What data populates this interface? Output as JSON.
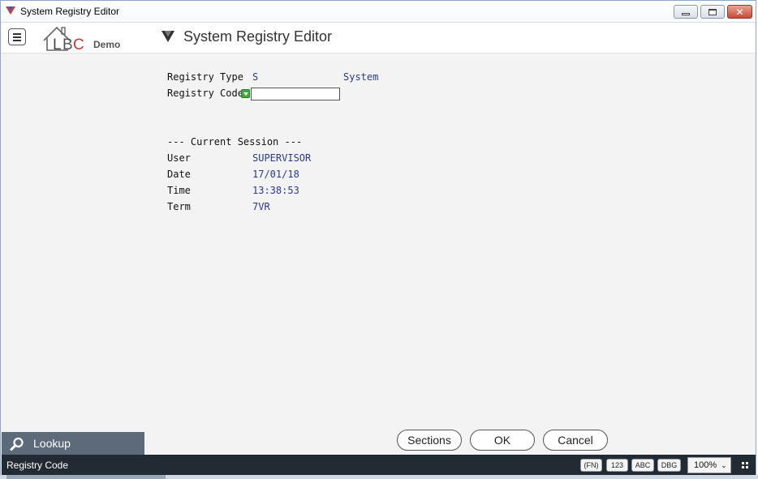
{
  "window": {
    "title": "System Registry Editor"
  },
  "header": {
    "logo_text": "Demo",
    "title": "System Registry Editor"
  },
  "form": {
    "registry_type": {
      "label": "Registry Type",
      "code": "S",
      "description": "System"
    },
    "registry_code": {
      "label": "Registry Code",
      "value": ""
    }
  },
  "session": {
    "heading": "--- Current Session ---",
    "user": {
      "label": "User",
      "value": "SUPERVISOR"
    },
    "date": {
      "label": "Date",
      "value": "17/01/18"
    },
    "time": {
      "label": "Time",
      "value": "13:38:53"
    },
    "term": {
      "label": "Term",
      "value": "7VR"
    }
  },
  "buttons": {
    "sections": "Sections",
    "ok": "OK",
    "cancel": "Cancel"
  },
  "lookup_panel": {
    "label": "Lookup"
  },
  "statusbar": {
    "field_name": "Registry Code",
    "chips": [
      "(FN)",
      "123",
      "ABC",
      "DBG"
    ],
    "zoom": "100%"
  },
  "colors": {
    "value_text": "#2a3a8a",
    "status_bg": "#222a33",
    "lookup_bg": "#5c6a7a",
    "lookup_indicator": "#3faa3f"
  }
}
